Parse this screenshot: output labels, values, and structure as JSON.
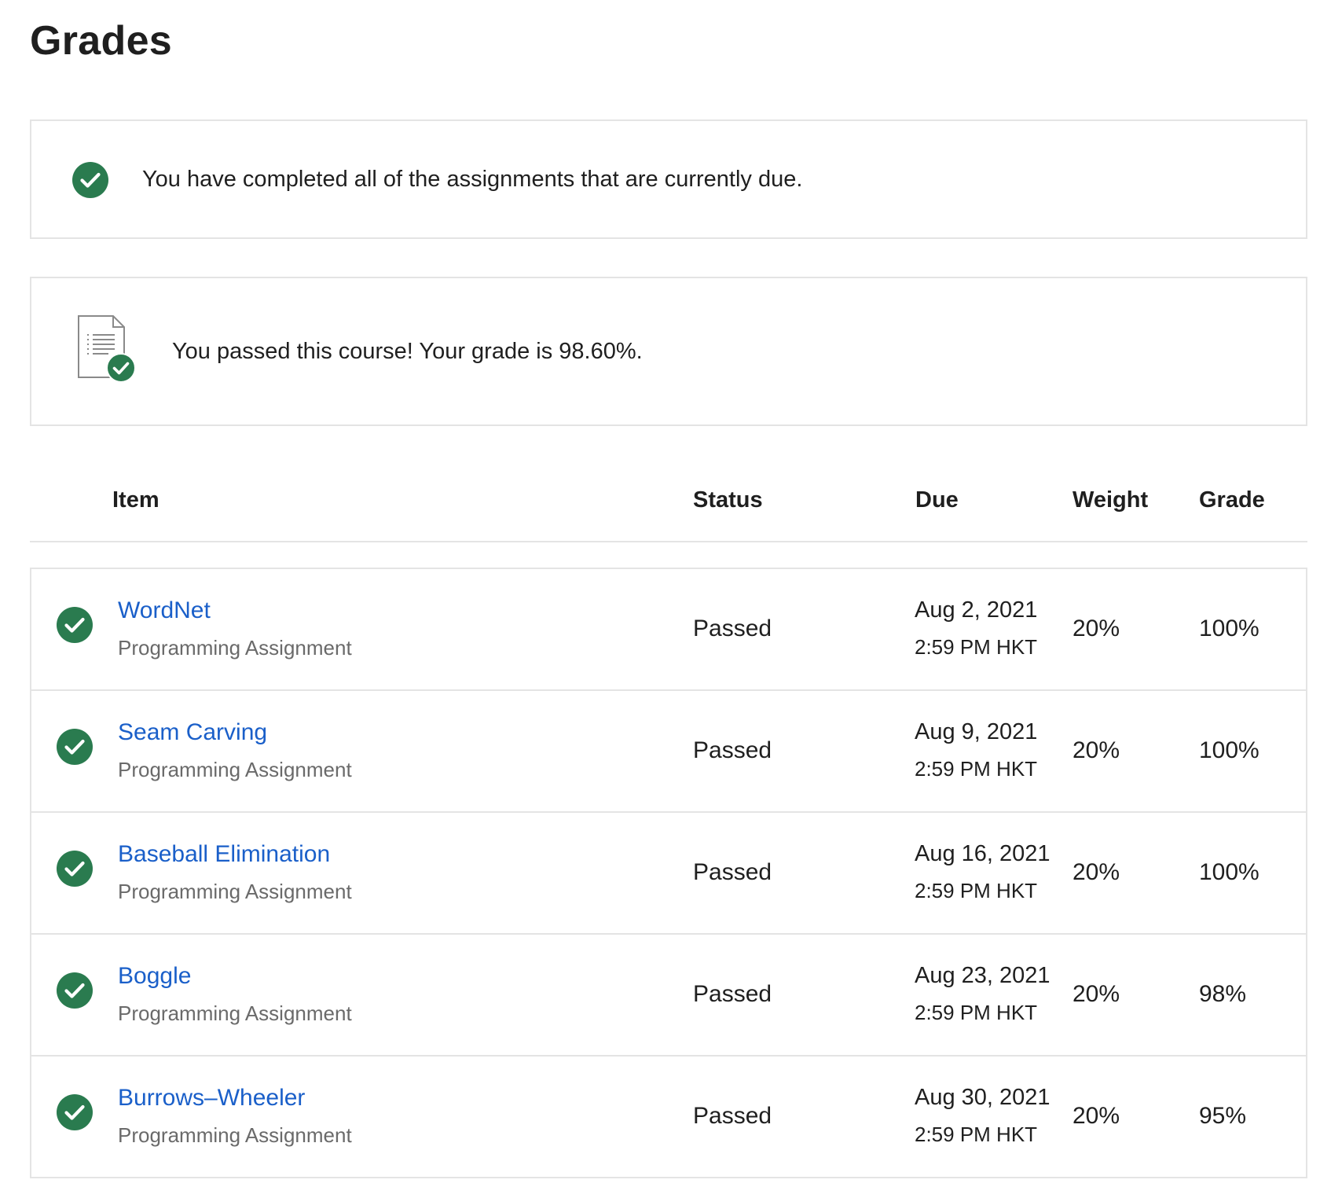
{
  "page": {
    "title": "Grades"
  },
  "colors": {
    "success_green": "#2a7b4f",
    "link_blue": "#1a5fc9",
    "secondary_text": "#6a6a6a",
    "border": "#e4e4e4"
  },
  "notices": {
    "due": {
      "icon": "check-circle-icon",
      "text": "You have completed all of the assignments that are currently due."
    },
    "passed": {
      "icon": "document-check-icon",
      "text": "You passed this course! Your grade is 98.60%."
    }
  },
  "table": {
    "headers": {
      "item": "Item",
      "status": "Status",
      "due": "Due",
      "weight": "Weight",
      "grade": "Grade"
    },
    "rows": [
      {
        "title": "WordNet",
        "type": "Programming Assignment",
        "status": "Passed",
        "due_date": "Aug 2, 2021",
        "due_time": "2:59 PM HKT",
        "weight": "20%",
        "grade": "100%"
      },
      {
        "title": "Seam Carving",
        "type": "Programming Assignment",
        "status": "Passed",
        "due_date": "Aug 9, 2021",
        "due_time": "2:59 PM HKT",
        "weight": "20%",
        "grade": "100%"
      },
      {
        "title": "Baseball Elimination",
        "type": "Programming Assignment",
        "status": "Passed",
        "due_date": "Aug 16, 2021",
        "due_time": "2:59 PM HKT",
        "weight": "20%",
        "grade": "100%"
      },
      {
        "title": "Boggle",
        "type": "Programming Assignment",
        "status": "Passed",
        "due_date": "Aug 23, 2021",
        "due_time": "2:59 PM HKT",
        "weight": "20%",
        "grade": "98%"
      },
      {
        "title": "Burrows–Wheeler",
        "type": "Programming Assignment",
        "status": "Passed",
        "due_date": "Aug 30, 2021",
        "due_time": "2:59 PM HKT",
        "weight": "20%",
        "grade": "95%"
      }
    ]
  }
}
